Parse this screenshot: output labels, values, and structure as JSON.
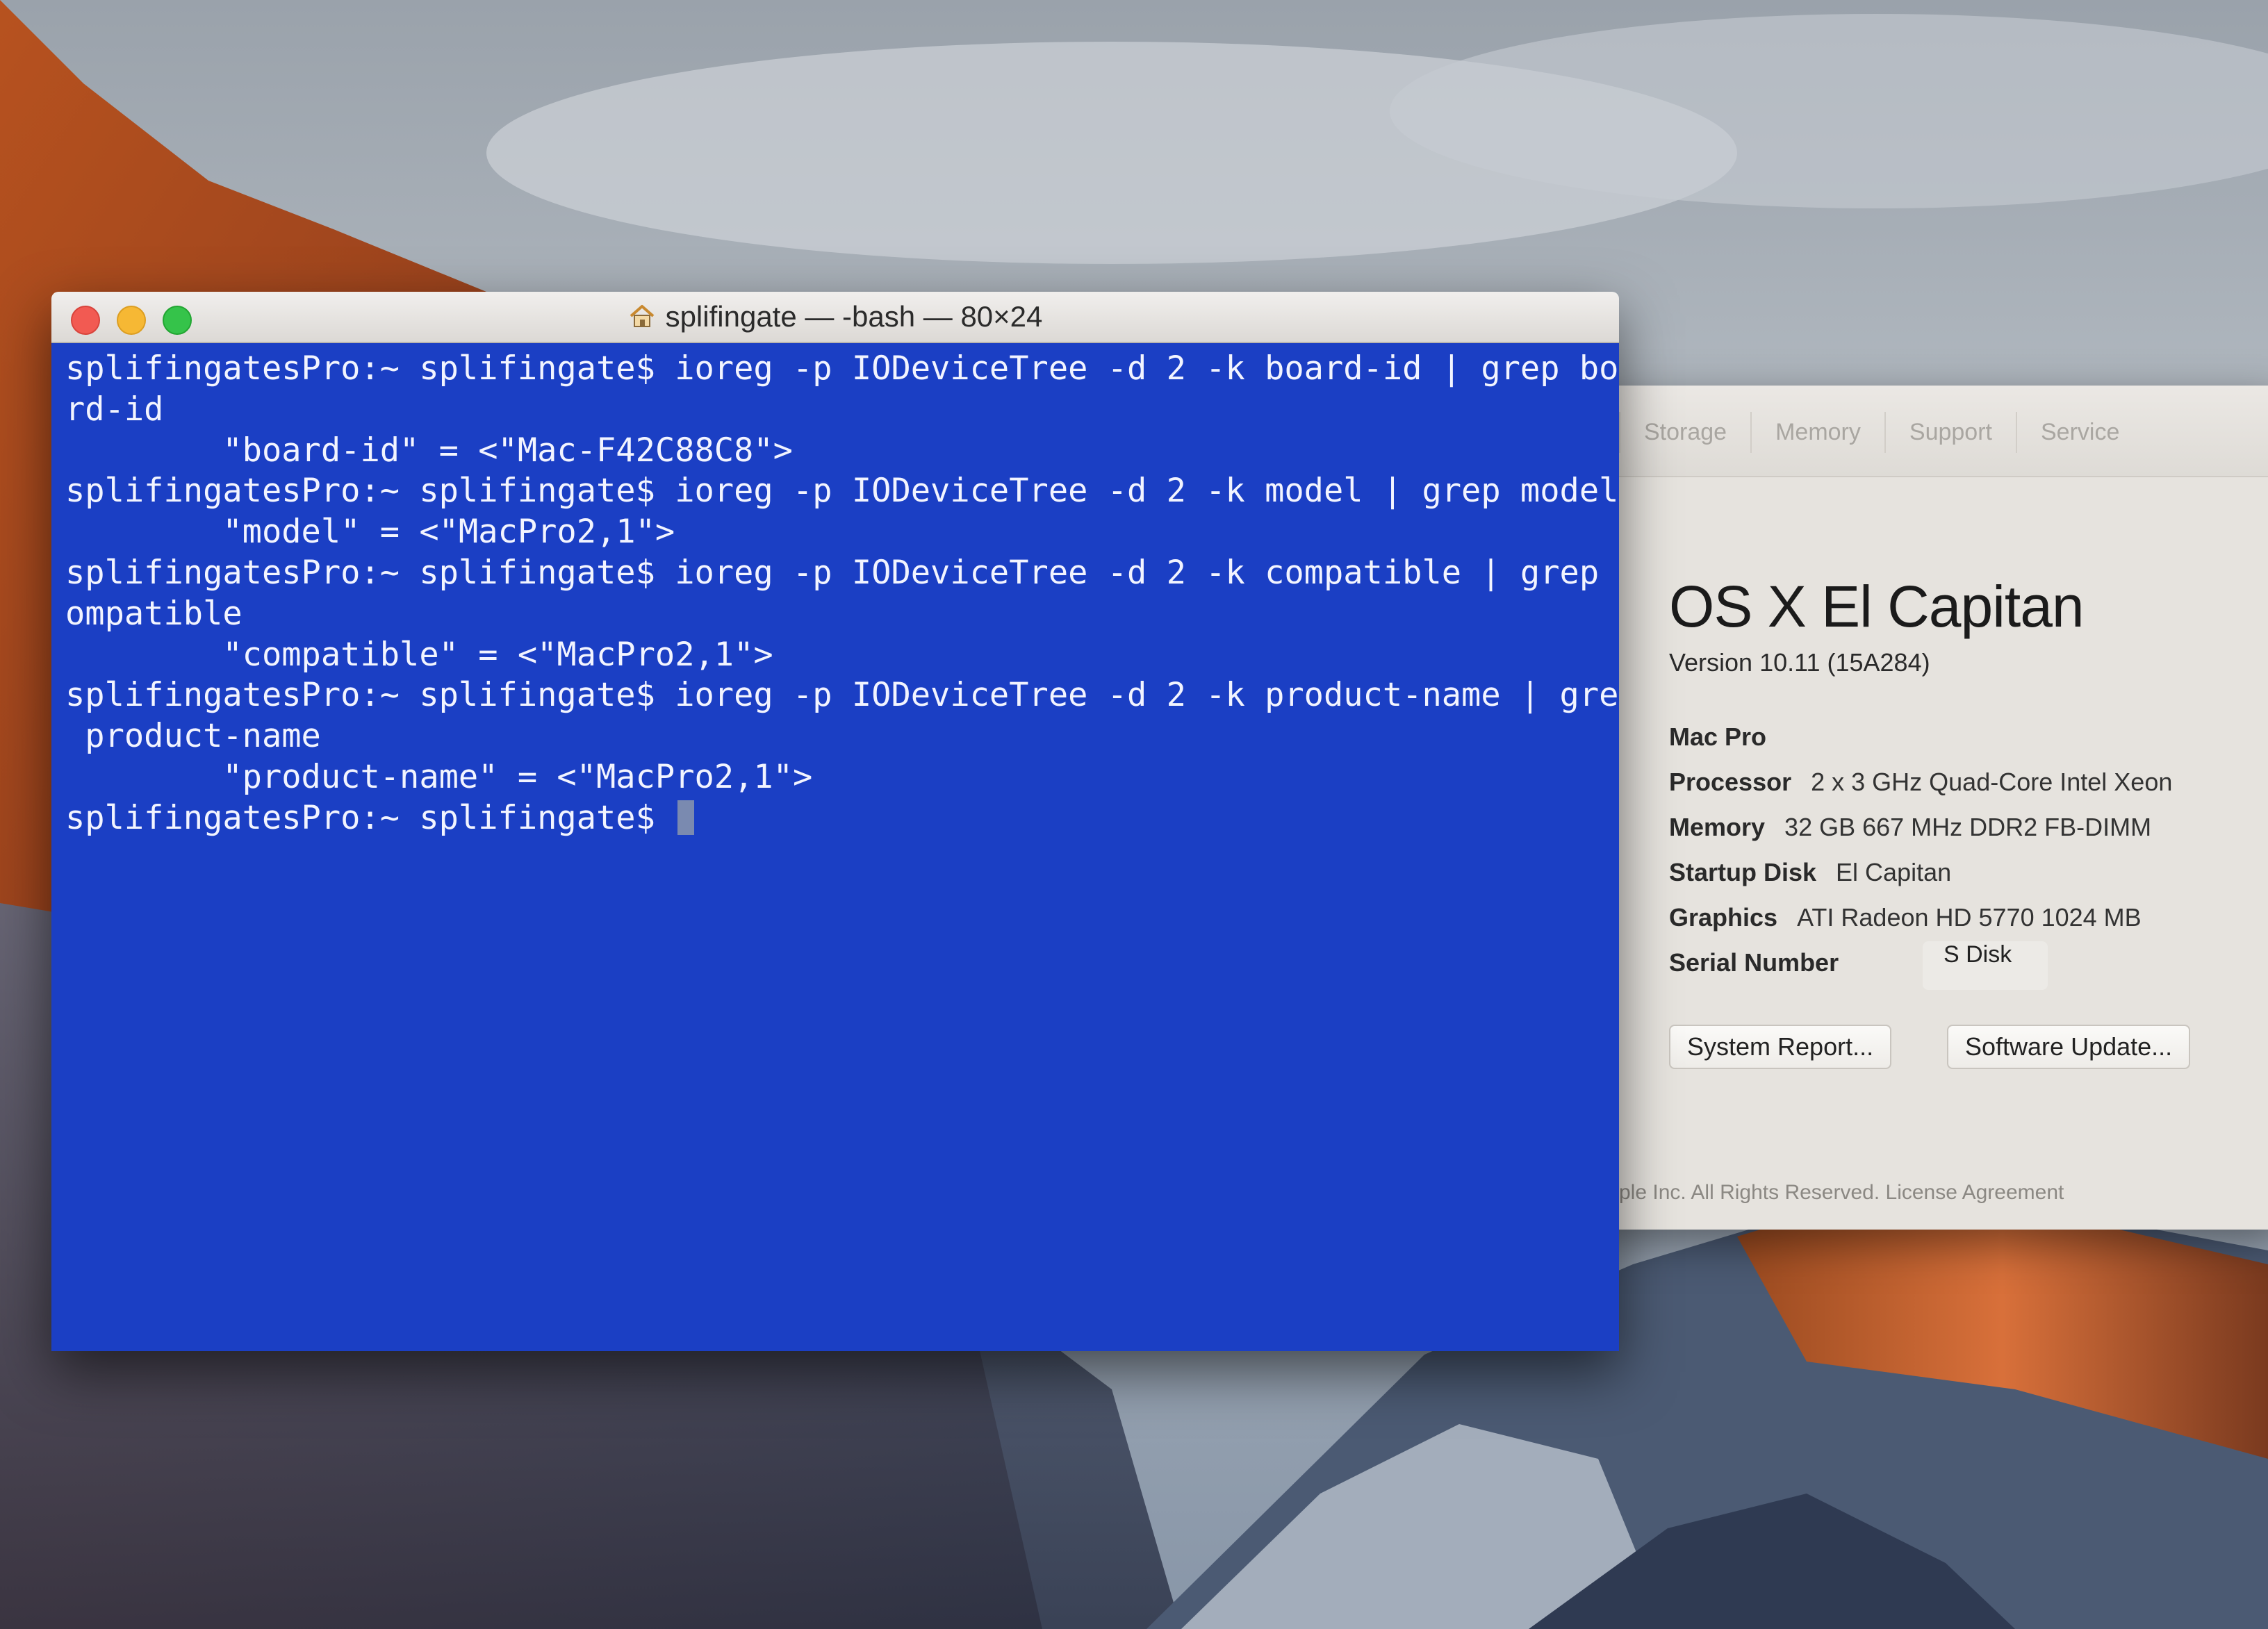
{
  "terminal": {
    "title": "splifingate — -bash — 80×24",
    "lines": [
      "splifingatesPro:~ splifingate$ ioreg -p IODeviceTree -d 2 -k board-id | grep boa",
      "rd-id",
      "        \"board-id\" = <\"Mac-F42C88C8\">",
      "splifingatesPro:~ splifingate$ ioreg -p IODeviceTree -d 2 -k model | grep model",
      "        \"model\" = <\"MacPro2,1\">",
      "splifingatesPro:~ splifingate$ ioreg -p IODeviceTree -d 2 -k compatible | grep c",
      "ompatible",
      "        \"compatible\" = <\"MacPro2,1\">",
      "splifingatesPro:~ splifingate$ ioreg -p IODeviceTree -d 2 -k product-name | grep",
      " product-name",
      "        \"product-name\" = <\"MacPro2,1\">"
    ],
    "prompt": "splifingatesPro:~ splifingate$ "
  },
  "about": {
    "tabs": [
      "Storage",
      "Memory",
      "Support",
      "Service"
    ],
    "os_name": "OS X El Capitan",
    "version": "Version 10.11 (15A284)",
    "model": "Mac Pro",
    "specs": {
      "processor_label": "Processor",
      "processor": "2 x 3 GHz Quad-Core Intel Xeon",
      "memory_label": "Memory",
      "memory": "32 GB 667 MHz DDR2 FB-DIMM",
      "startup_label": "Startup Disk",
      "startup": "El Capitan",
      "graphics_label": "Graphics",
      "graphics": "ATI Radeon HD 5770 1024 MB",
      "serial_label": "Serial Number",
      "serial_partial": "S  Disk"
    },
    "buttons": {
      "system_report": "System Report...",
      "software_update": "Software Update..."
    },
    "footer": "ple Inc. All Rights Reserved. License Agreement"
  },
  "colors": {
    "terminal_bg": "#1b3fc4",
    "terminal_fg": "#f2f4ff"
  }
}
